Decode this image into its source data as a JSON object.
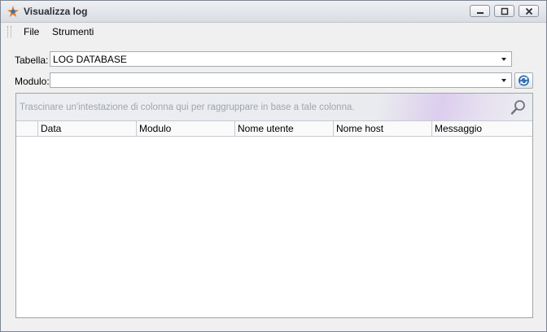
{
  "window": {
    "title": "Visualizza log"
  },
  "menu": {
    "items": [
      "File",
      "Strumenti"
    ]
  },
  "form": {
    "tabella_label": "Tabella:",
    "tabella_value": "LOG DATABASE",
    "modulo_label": "Modulo:",
    "modulo_value": ""
  },
  "grid": {
    "group_panel_text": "Trascinare un'intestazione di colonna qui per raggruppare in base a tale colonna.",
    "columns": [
      "Data",
      "Modulo",
      "Nome utente",
      "Nome host",
      "Messaggio"
    ],
    "rows": []
  },
  "icons": {
    "app": "app-icon",
    "refresh": "refresh-icon",
    "search": "search-icon",
    "minimize": "minimize-icon",
    "maximize": "maximize-icon",
    "close": "close-icon"
  },
  "colors": {
    "accent_blue": "#2f6fb3",
    "panel_lilac": "#dccdee"
  }
}
